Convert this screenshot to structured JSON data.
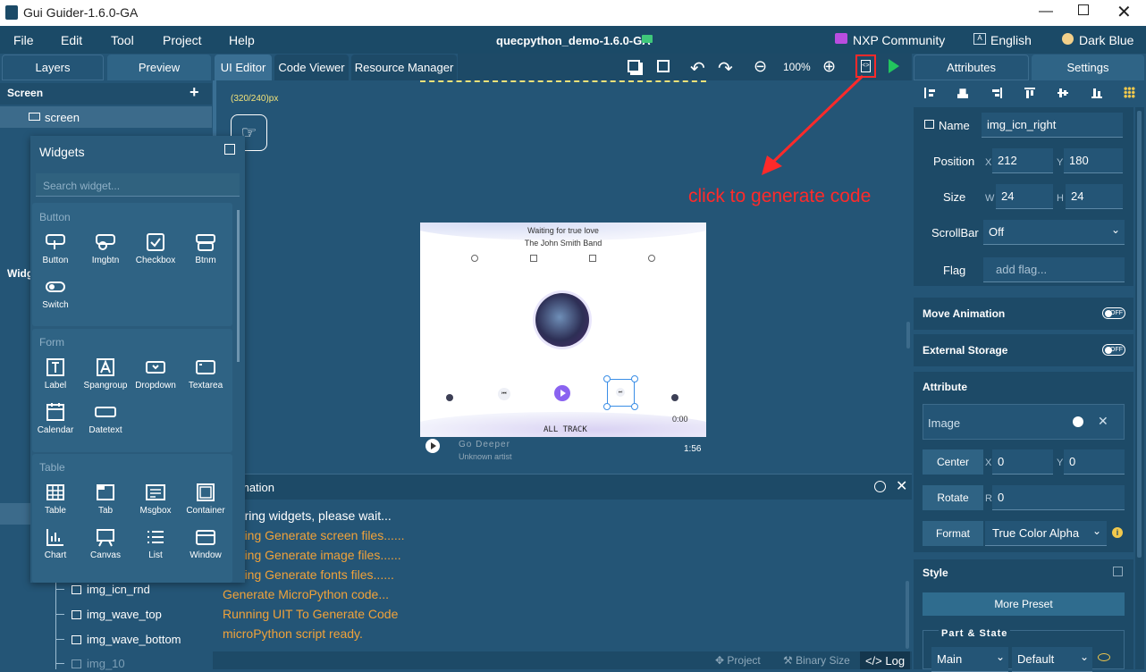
{
  "window": {
    "title": "Gui Guider-1.6.0-GA",
    "project": "quecpython_demo-1.6.0-GA"
  },
  "menu": [
    "File",
    "Edit",
    "Tool",
    "Project",
    "Help"
  ],
  "menu_right": {
    "community": "NXP Community",
    "language": "English",
    "theme": "Dark Blue"
  },
  "left_tabs": [
    "Layers",
    "Preview"
  ],
  "center_tabs": [
    "UI Editor",
    "Code Viewer",
    "Resource Manager"
  ],
  "right_tabs": [
    "Attributes",
    "Settings"
  ],
  "zoom": "100%",
  "screen_section": {
    "title": "Screen",
    "item": "screen"
  },
  "canvas": {
    "size_label": "(320/240)px",
    "annotation": "click to generate code"
  },
  "widgets": {
    "title": "Widgets",
    "search_placeholder": "Search widget...",
    "side_label": "Widg",
    "categories": [
      {
        "name": "Button",
        "items": [
          "Button",
          "Imgbtn",
          "Checkbox",
          "Btnm",
          "Switch"
        ]
      },
      {
        "name": "Form",
        "items": [
          "Label",
          "Spangroup",
          "Dropdown",
          "Textarea",
          "Calendar",
          "Datetext"
        ]
      },
      {
        "name": "Table",
        "items": [
          "Table",
          "Tab",
          "Msgbox",
          "Container",
          "Chart",
          "Canvas",
          "List",
          "Window"
        ]
      }
    ]
  },
  "layers": [
    "img_icn_rnd",
    "img_wave_top",
    "img_wave_bottom",
    "img_10"
  ],
  "player": {
    "song": "Waiting for true love",
    "artist": "The John Smith Band",
    "time": "0:00",
    "all_track": "ALL TRACK",
    "next_song": "Go Deeper",
    "next_artist": "Unknown artist",
    "duration": "1:56"
  },
  "log": {
    "title": "mation",
    "lines": [
      "paring widgets, please wait...",
      "nning Generate screen files......",
      "nning Generate image files......",
      "nning Generate fonts files......",
      "Generate MicroPython code...",
      "Running UIT To Generate Code",
      "microPython script ready."
    ]
  },
  "status": [
    "Project",
    "Binary Size",
    "Log"
  ],
  "attributes": {
    "name_label": "Name",
    "name": "img_icn_right",
    "position_label": "Position",
    "x": "212",
    "y": "180",
    "size_label": "Size",
    "w": "24",
    "h": "24",
    "scrollbar_label": "ScrollBar",
    "scrollbar": "Off",
    "flag_label": "Flag",
    "flag_placeholder": "add flag...",
    "move_animation": "Move Animation",
    "external_storage": "External Storage",
    "toggle_off": "OFF",
    "attribute_title": "Attribute",
    "image_label": "Image",
    "center_label": "Center",
    "center_x": "0",
    "center_y": "0",
    "rotate_label": "Rotate",
    "rotate_r": "0",
    "format_label": "Format",
    "format": "True Color Alpha",
    "style_title": "Style",
    "more_preset": "More Preset",
    "part_state": "Part & State",
    "part": "Main",
    "state": "Default"
  },
  "colors": {
    "accent": "#3a8ee6",
    "annotation": "#ff2a2a",
    "log": "#f0a23a",
    "play": "#22c55e"
  }
}
